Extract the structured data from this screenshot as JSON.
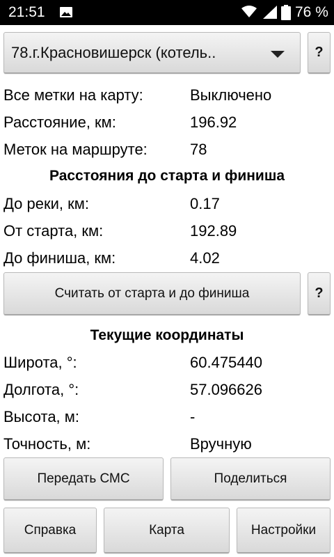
{
  "status_bar": {
    "time": "21:51",
    "battery": "76 %"
  },
  "route_select": {
    "selected": "78.г.Красновишерск (котель..",
    "help": "?"
  },
  "info": [
    {
      "label": "Все метки на карту:",
      "value": "Выключено"
    },
    {
      "label": "Расстояние, км:",
      "value": "196.92"
    },
    {
      "label": "Меток на маршруте:",
      "value": "78"
    }
  ],
  "distances": {
    "title": "Расстояния до старта и финиша",
    "rows": [
      {
        "label": "До реки, км:",
        "value": "0.17"
      },
      {
        "label": "От старта, км:",
        "value": "192.89"
      },
      {
        "label": "До финиша, км:",
        "value": "4.02"
      }
    ],
    "calc_button": "Считать от старта и до финиша",
    "help": "?"
  },
  "coordinates": {
    "title": "Текущие координаты",
    "rows": [
      {
        "label": "Широта, °:",
        "value": "60.475440"
      },
      {
        "label": "Долгота, °:",
        "value": "57.096626"
      },
      {
        "label": "Высота, м:",
        "value": "-"
      },
      {
        "label": "Точность, м:",
        "value": "Вручную"
      }
    ]
  },
  "buttons": {
    "sms": "Передать СМС",
    "share": "Поделиться",
    "help": "Справка",
    "map": "Карта",
    "settings": "Настройки"
  }
}
